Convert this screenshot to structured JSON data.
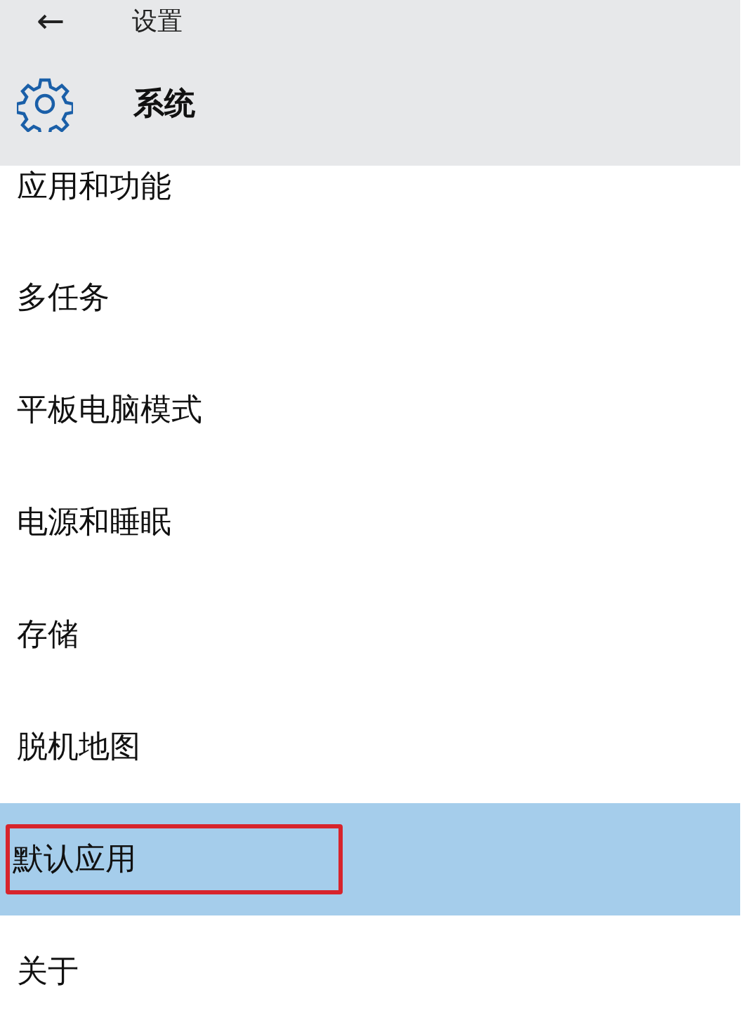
{
  "header": {
    "back_icon": "←",
    "title": "设置"
  },
  "section": {
    "title": "系统"
  },
  "items": [
    {
      "label": "应用和功能",
      "selected": false,
      "outlined": false
    },
    {
      "label": "多任务",
      "selected": false,
      "outlined": false
    },
    {
      "label": "平板电脑模式",
      "selected": false,
      "outlined": false
    },
    {
      "label": "电源和睡眠",
      "selected": false,
      "outlined": false
    },
    {
      "label": "存储",
      "selected": false,
      "outlined": false
    },
    {
      "label": "脱机地图",
      "selected": false,
      "outlined": false
    },
    {
      "label": "默认应用",
      "selected": true,
      "outlined": true
    },
    {
      "label": "关于",
      "selected": false,
      "outlined": false
    }
  ]
}
